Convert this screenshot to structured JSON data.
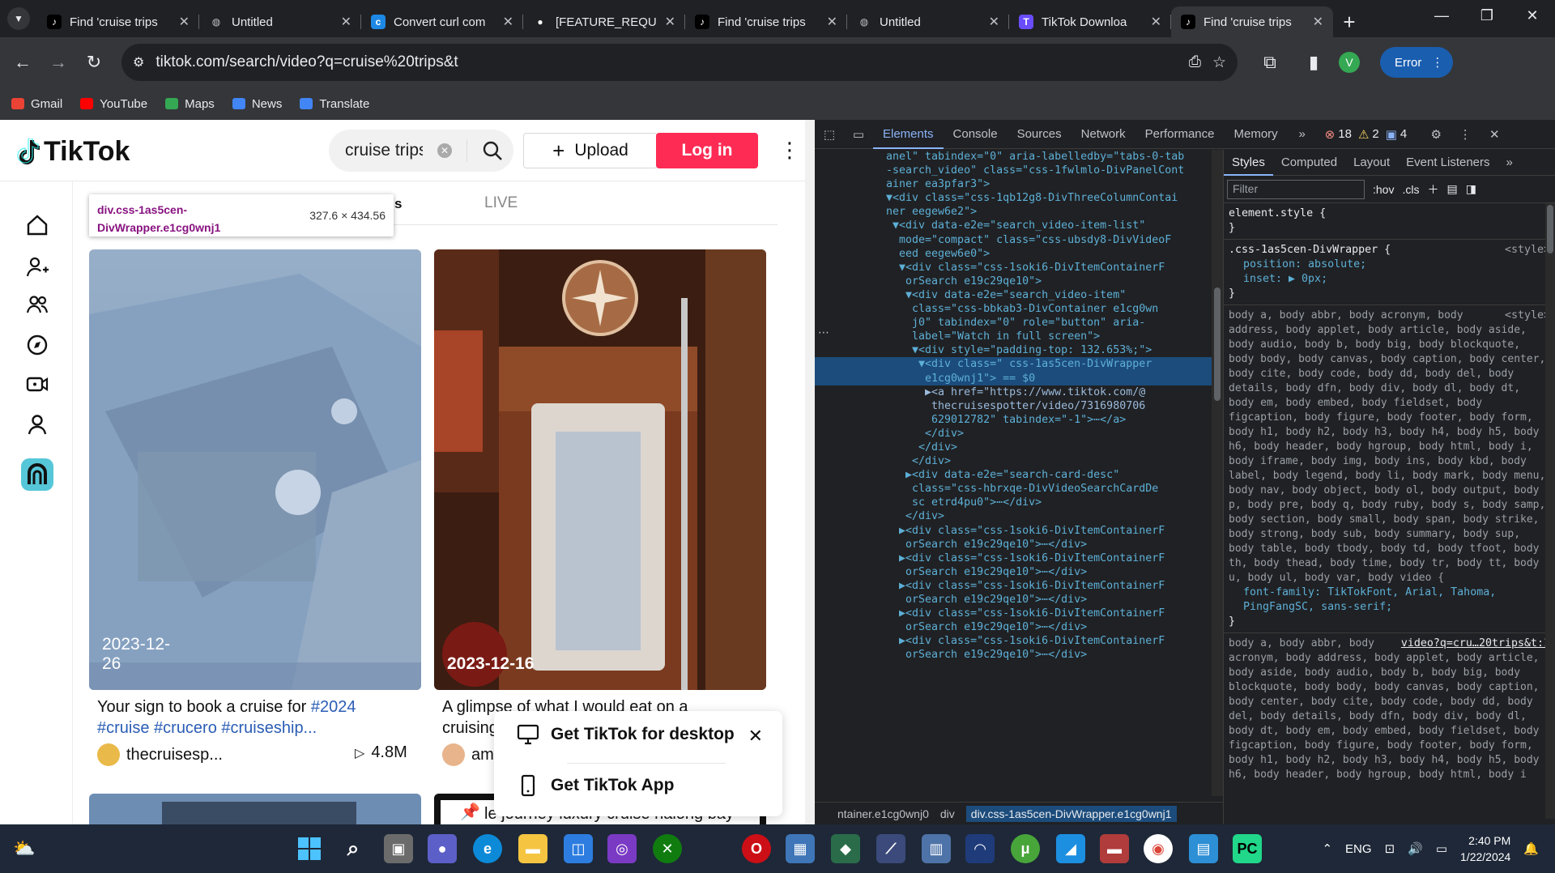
{
  "browser": {
    "tabs": [
      {
        "title": "Find 'cruise trips",
        "icon": "tiktok-icon",
        "active": false
      },
      {
        "title": "Untitled",
        "icon": "globe-icon",
        "active": false
      },
      {
        "title": "Convert curl com",
        "icon": "curlconverter-icon",
        "active": false
      },
      {
        "title": "[FEATURE_REQU",
        "icon": "github-icon",
        "active": false
      },
      {
        "title": "Find 'cruise trips",
        "icon": "tiktok-icon",
        "active": false
      },
      {
        "title": "Untitled",
        "icon": "globe-icon",
        "active": false
      },
      {
        "title": "TikTok Downloa",
        "icon": "downloader-icon",
        "active": false
      },
      {
        "title": "Find 'cruise trips",
        "icon": "tiktok-icon",
        "active": true
      }
    ],
    "url": "tiktok.com/search/video?q=cruise%20trips&t",
    "profile_initial": "V",
    "error_label": "Error",
    "bookmarks": [
      {
        "label": "Gmail",
        "icon": "gmail-icon",
        "color": "#ea4335"
      },
      {
        "label": "YouTube",
        "icon": "youtube-icon",
        "color": "#ff0000"
      },
      {
        "label": "Maps",
        "icon": "maps-icon",
        "color": "#34a853"
      },
      {
        "label": "News",
        "icon": "news-icon",
        "color": "#4285f4"
      },
      {
        "label": "Translate",
        "icon": "translate-icon",
        "color": "#4285f4"
      }
    ]
  },
  "tiktok": {
    "logo": "TikTok",
    "search_value": "cruise trips",
    "upload_label": "Upload",
    "login_label": "Log in",
    "live_tab": "LIVE",
    "tooltip": {
      "selector": "div.css-1as5cen-DivWrapper.e1cg0wnj1",
      "size": "327.6 × 434.56"
    },
    "videos": [
      {
        "date": "2023-12-26",
        "desc_text": "Your sign to book a cruise for ",
        "tags": "#2024",
        "tags2": "#cruise #crucero #cruiseship...",
        "user": "thecruisesp...",
        "views": "4.8M"
      },
      {
        "date": "2023-12-16",
        "desc_text": "A glimpse of what I would eat on a",
        "desc_line2": "cruising",
        "user": "am"
      }
    ],
    "bottom_card_text": "le journey luxury cruise halong bay",
    "popup": {
      "desktop": "Get TikTok for desktop",
      "app": "Get TikTok App"
    }
  },
  "devtools": {
    "tabs": [
      "Elements",
      "Console",
      "Sources",
      "Network",
      "Performance",
      "Memory"
    ],
    "active_tab": "Elements",
    "errors": "18",
    "warnings": "2",
    "issues": "4",
    "style_tabs": [
      "Styles",
      "Computed",
      "Layout",
      "Event Listeners"
    ],
    "filter_placeholder": "Filter",
    "hov": ":hov",
    "cls": ".cls",
    "dom_lines": [
      "anel\" tabindex=\"0\" aria-labelledby=\"tabs-0-tab",
      "-search_video\" class=\"css-1fwlmlo-DivPanelCont",
      "ainer ea3pfar3\">",
      "▼<div class=\"css-1qb12g8-DivThreeColumnContai",
      "ner eegew6e2\">",
      " ▼<div data-e2e=\"search_video-item-list\"",
      "  mode=\"compact\" class=\"css-ubsdy8-DivVideoF",
      "  eed eegew6e0\">",
      "  ▼<div class=\"css-1soki6-DivItemContainerF",
      "   orSearch e19c29qe10\">",
      "   ▼<div data-e2e=\"search_video-item\"",
      "    class=\"css-bbkab3-DivContainer e1cg0wn",
      "    j0\" tabindex=\"0\" role=\"button\" aria-",
      "    label=\"Watch in full screen\">",
      "    ▼<div style=\"padding-top: 132.653%;\">",
      "     ▼<div class=\" css-1as5cen-DivWrapper",
      "      e1cg0wnj1\"> == $0",
      "      ▶<a href=\"https://www.tiktok.com/@",
      "       thecruisespotter/video/7316980706",
      "       629012782\" tabindex=\"-1\">⋯</a>",
      "      </div>",
      "     </div>",
      "    </div>",
      "   ▶<div data-e2e=\"search-card-desc\"",
      "    class=\"css-hbrxqe-DivVideoSearchCardDe",
      "    sc etrd4pu0\">⋯</div>",
      "   </div>",
      "  ▶<div class=\"css-1soki6-DivItemContainerF",
      "   orSearch e19c29qe10\">⋯</div>",
      "  ▶<div class=\"css-1soki6-DivItemContainerF",
      "   orSearch e19c29qe10\">⋯</div>",
      "  ▶<div class=\"css-1soki6-DivItemContainerF",
      "   orSearch e19c29qe10\">⋯</div>",
      "  ▶<div class=\"css-1soki6-DivItemContainerF",
      "   orSearch e19c29qe10\">⋯</div>",
      "  ▶<div class=\"css-1soki6-DivItemContainerF",
      "   orSearch e19c29qe10\">⋯</div>"
    ],
    "crumbs": [
      "ntainer.e1cg0wnj0",
      "div",
      "div.css-1as5cen-DivWrapper.e1cg0wnj1"
    ],
    "styles": {
      "element_style": "element.style {",
      "rule1_selector": ".css-1as5cen-DivWrapper {",
      "rule1_src": "<style>",
      "rule1_props": [
        "position: absolute;",
        "inset: ▶ 0px;"
      ],
      "rule2_src": "<style>",
      "rule2_text": "body a, body abbr, body acronym, body address, body applet, body article, body aside, body audio, body b, body big, body blockquote, body body, body canvas, body caption, body center, body cite, body code, body dd, body del, body details, body dfn, body div, body dl, body dt, body em, body embed, body fieldset, body figcaption, body figure, body footer, body form, body h1, body h2, body h3, body h4, body h5, body h6, body header, body hgroup, body html, body i, body iframe, body img, body ins, body kbd, body label, body legend, body li, body mark, body menu, body nav, body object, body ol, body output, body p, body pre, body q, body ruby, body s, body samp, body section, body small, body span, body strike, body strong, body sub, body summary, body sup, body table, body tbody, body td, body tfoot, body th, body thead, body time, body tr, body tt, body u, body ul, body var, body video {",
      "rule2_prop": "font-family: TikTokFont, Arial, Tahoma, PingFangSC, sans-serif;",
      "rule3_src": "video?q=cru…20trips&t:1",
      "rule3_text": "body a, body abbr, body acronym, body address, body applet, body article, body aside, body audio, body b, body big, body blockquote, body body, body canvas, body caption, body center, body cite, body code, body dd, body del, body details, body dfn, body div, body dl, body dt, body em, body embed, body fieldset, body figcaption, body figure, body footer, body form, body h1, body h2, body h3, body h4, body h5, body h6, body header, body hgroup, body html, body i"
    }
  },
  "taskbar": {
    "lang": "ENG",
    "time": "2:40 PM",
    "date": "1/22/2024"
  }
}
